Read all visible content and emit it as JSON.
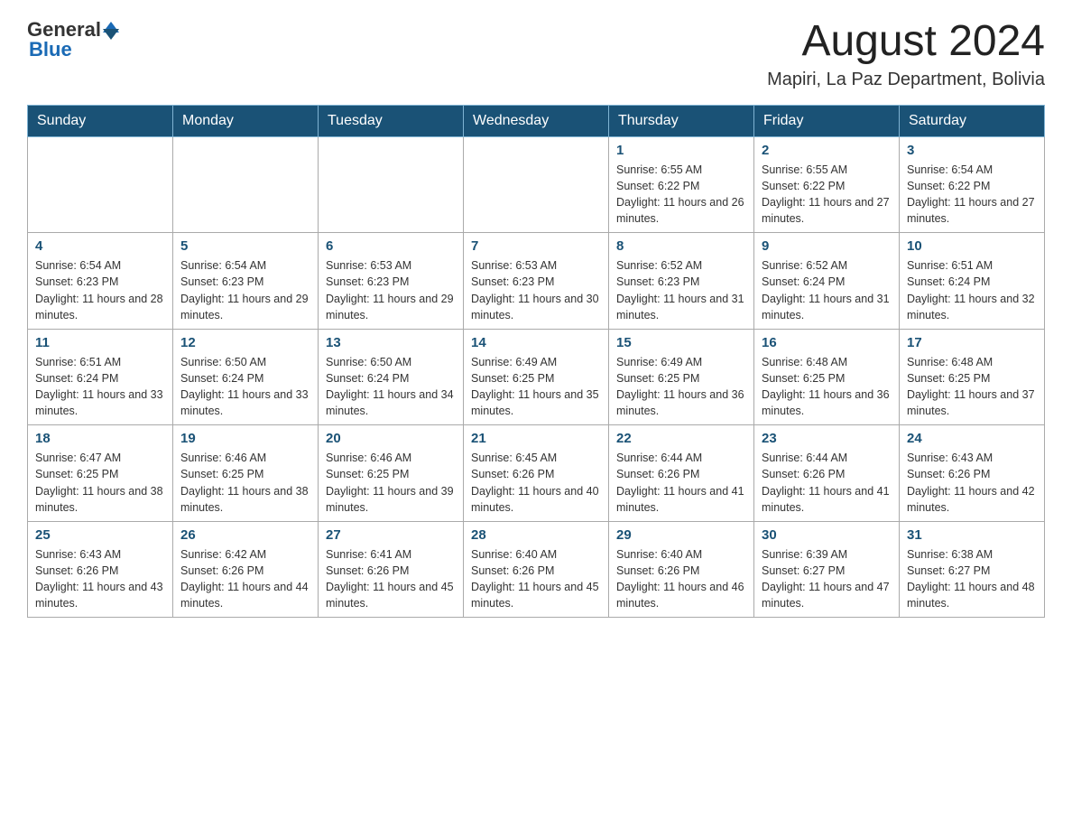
{
  "header": {
    "logo_text_general": "General",
    "logo_text_blue": "Blue",
    "main_title": "August 2024",
    "subtitle": "Mapiri, La Paz Department, Bolivia"
  },
  "calendar": {
    "days_of_week": [
      "Sunday",
      "Monday",
      "Tuesday",
      "Wednesday",
      "Thursday",
      "Friday",
      "Saturday"
    ],
    "weeks": [
      [
        {
          "day": "",
          "info": ""
        },
        {
          "day": "",
          "info": ""
        },
        {
          "day": "",
          "info": ""
        },
        {
          "day": "",
          "info": ""
        },
        {
          "day": "1",
          "info": "Sunrise: 6:55 AM\nSunset: 6:22 PM\nDaylight: 11 hours and 26 minutes."
        },
        {
          "day": "2",
          "info": "Sunrise: 6:55 AM\nSunset: 6:22 PM\nDaylight: 11 hours and 27 minutes."
        },
        {
          "day": "3",
          "info": "Sunrise: 6:54 AM\nSunset: 6:22 PM\nDaylight: 11 hours and 27 minutes."
        }
      ],
      [
        {
          "day": "4",
          "info": "Sunrise: 6:54 AM\nSunset: 6:23 PM\nDaylight: 11 hours and 28 minutes."
        },
        {
          "day": "5",
          "info": "Sunrise: 6:54 AM\nSunset: 6:23 PM\nDaylight: 11 hours and 29 minutes."
        },
        {
          "day": "6",
          "info": "Sunrise: 6:53 AM\nSunset: 6:23 PM\nDaylight: 11 hours and 29 minutes."
        },
        {
          "day": "7",
          "info": "Sunrise: 6:53 AM\nSunset: 6:23 PM\nDaylight: 11 hours and 30 minutes."
        },
        {
          "day": "8",
          "info": "Sunrise: 6:52 AM\nSunset: 6:23 PM\nDaylight: 11 hours and 31 minutes."
        },
        {
          "day": "9",
          "info": "Sunrise: 6:52 AM\nSunset: 6:24 PM\nDaylight: 11 hours and 31 minutes."
        },
        {
          "day": "10",
          "info": "Sunrise: 6:51 AM\nSunset: 6:24 PM\nDaylight: 11 hours and 32 minutes."
        }
      ],
      [
        {
          "day": "11",
          "info": "Sunrise: 6:51 AM\nSunset: 6:24 PM\nDaylight: 11 hours and 33 minutes."
        },
        {
          "day": "12",
          "info": "Sunrise: 6:50 AM\nSunset: 6:24 PM\nDaylight: 11 hours and 33 minutes."
        },
        {
          "day": "13",
          "info": "Sunrise: 6:50 AM\nSunset: 6:24 PM\nDaylight: 11 hours and 34 minutes."
        },
        {
          "day": "14",
          "info": "Sunrise: 6:49 AM\nSunset: 6:25 PM\nDaylight: 11 hours and 35 minutes."
        },
        {
          "day": "15",
          "info": "Sunrise: 6:49 AM\nSunset: 6:25 PM\nDaylight: 11 hours and 36 minutes."
        },
        {
          "day": "16",
          "info": "Sunrise: 6:48 AM\nSunset: 6:25 PM\nDaylight: 11 hours and 36 minutes."
        },
        {
          "day": "17",
          "info": "Sunrise: 6:48 AM\nSunset: 6:25 PM\nDaylight: 11 hours and 37 minutes."
        }
      ],
      [
        {
          "day": "18",
          "info": "Sunrise: 6:47 AM\nSunset: 6:25 PM\nDaylight: 11 hours and 38 minutes."
        },
        {
          "day": "19",
          "info": "Sunrise: 6:46 AM\nSunset: 6:25 PM\nDaylight: 11 hours and 38 minutes."
        },
        {
          "day": "20",
          "info": "Sunrise: 6:46 AM\nSunset: 6:25 PM\nDaylight: 11 hours and 39 minutes."
        },
        {
          "day": "21",
          "info": "Sunrise: 6:45 AM\nSunset: 6:26 PM\nDaylight: 11 hours and 40 minutes."
        },
        {
          "day": "22",
          "info": "Sunrise: 6:44 AM\nSunset: 6:26 PM\nDaylight: 11 hours and 41 minutes."
        },
        {
          "day": "23",
          "info": "Sunrise: 6:44 AM\nSunset: 6:26 PM\nDaylight: 11 hours and 41 minutes."
        },
        {
          "day": "24",
          "info": "Sunrise: 6:43 AM\nSunset: 6:26 PM\nDaylight: 11 hours and 42 minutes."
        }
      ],
      [
        {
          "day": "25",
          "info": "Sunrise: 6:43 AM\nSunset: 6:26 PM\nDaylight: 11 hours and 43 minutes."
        },
        {
          "day": "26",
          "info": "Sunrise: 6:42 AM\nSunset: 6:26 PM\nDaylight: 11 hours and 44 minutes."
        },
        {
          "day": "27",
          "info": "Sunrise: 6:41 AM\nSunset: 6:26 PM\nDaylight: 11 hours and 45 minutes."
        },
        {
          "day": "28",
          "info": "Sunrise: 6:40 AM\nSunset: 6:26 PM\nDaylight: 11 hours and 45 minutes."
        },
        {
          "day": "29",
          "info": "Sunrise: 6:40 AM\nSunset: 6:26 PM\nDaylight: 11 hours and 46 minutes."
        },
        {
          "day": "30",
          "info": "Sunrise: 6:39 AM\nSunset: 6:27 PM\nDaylight: 11 hours and 47 minutes."
        },
        {
          "day": "31",
          "info": "Sunrise: 6:38 AM\nSunset: 6:27 PM\nDaylight: 11 hours and 48 minutes."
        }
      ]
    ]
  }
}
